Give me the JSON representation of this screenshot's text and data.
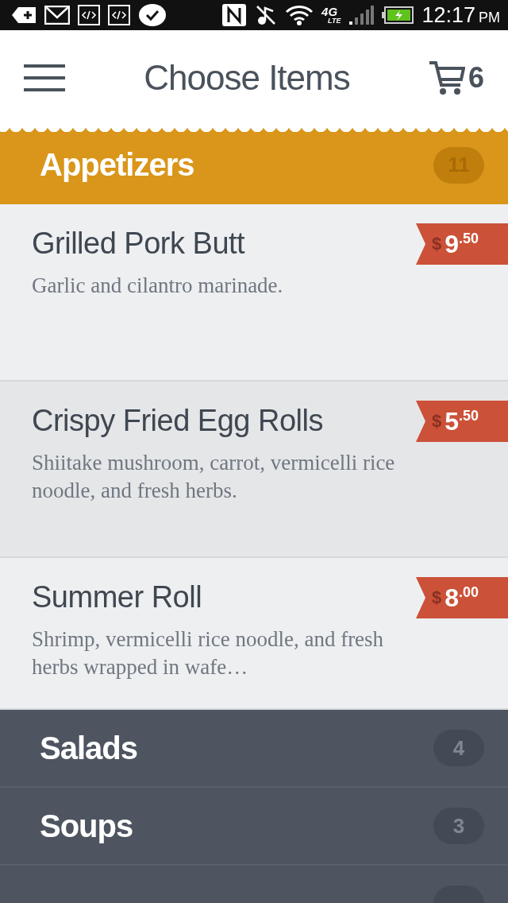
{
  "status_bar": {
    "network": "4G",
    "network_sub": "LTE",
    "time": "12:17",
    "ampm": "PM"
  },
  "header": {
    "title": "Choose Items",
    "cart_count": "6"
  },
  "categories": [
    {
      "name": "Appetizers",
      "count": "11",
      "expanded": true,
      "items": [
        {
          "name": "Grilled Pork Butt",
          "description": "Garlic and cilantro marinade.",
          "price": {
            "currency": "$",
            "whole": "9",
            "cents": ".50"
          },
          "selected": false
        },
        {
          "name": "Crispy Fried Egg Rolls",
          "description": "Shiitake mushroom, carrot, vermicelli rice noodle, and fresh herbs.",
          "price": {
            "currency": "$",
            "whole": "5",
            "cents": ".50"
          },
          "selected": true
        },
        {
          "name": "Summer Roll",
          "description": "Shrimp, vermicelli rice noodle, and fresh herbs wrapped in wafe…",
          "price": {
            "currency": "$",
            "whole": "8",
            "cents": ".00"
          },
          "selected": false
        }
      ]
    },
    {
      "name": "Salads",
      "count": "4",
      "expanded": false
    },
    {
      "name": "Soups",
      "count": "3",
      "expanded": false
    },
    {
      "expanded": false
    }
  ]
}
